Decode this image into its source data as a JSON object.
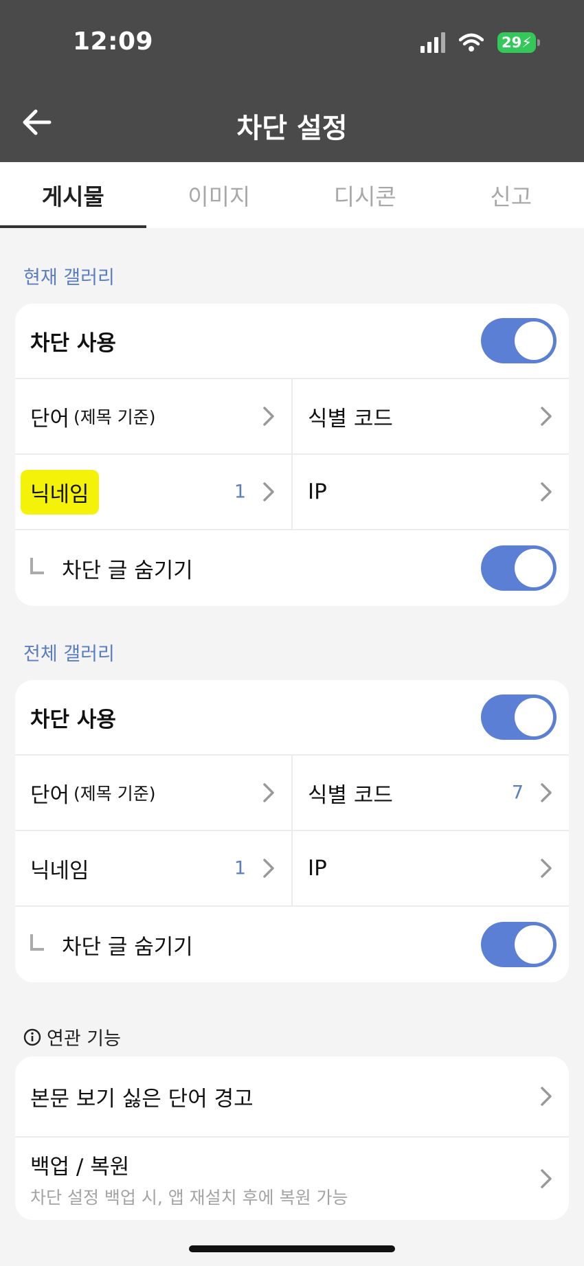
{
  "status_bar": {
    "time": "12:09",
    "battery": "29"
  },
  "header": {
    "title": "차단 설정"
  },
  "tabs": [
    {
      "label": "게시물",
      "active": true
    },
    {
      "label": "이미지",
      "active": false
    },
    {
      "label": "디시콘",
      "active": false
    },
    {
      "label": "신고",
      "active": false
    }
  ],
  "current_gallery": {
    "section_label": "현재 갤러리",
    "use_block_label": "차단 사용",
    "use_block_on": true,
    "word_label": "단어",
    "word_sub": "(제목 기준)",
    "id_code_label": "식별 코드",
    "id_code_count": "",
    "nickname_label": "닉네임",
    "nickname_count": "1",
    "ip_label": "IP",
    "hide_label": "차단 글 숨기기",
    "hide_on": true
  },
  "all_gallery": {
    "section_label": "전체 갤러리",
    "use_block_label": "차단 사용",
    "use_block_on": true,
    "word_label": "단어",
    "word_sub": "(제목 기준)",
    "id_code_label": "식별 코드",
    "id_code_count": "7",
    "nickname_label": "닉네임",
    "nickname_count": "1",
    "ip_label": "IP",
    "hide_label": "차단 글 숨기기",
    "hide_on": true
  },
  "related": {
    "section_label": "연관 기능",
    "items": [
      {
        "title": "본문 보기 싫은 단어 경고",
        "subtitle": ""
      },
      {
        "title": "백업 / 복원",
        "subtitle": "차단 설정 백업 시, 앱 재설치 후에 복원 가능"
      }
    ]
  },
  "colors": {
    "accent": "#5b7fd4",
    "header_bg": "#4a4a4a",
    "highlight": "#f5f20a"
  },
  "icons": [
    "back-arrow-icon",
    "chevron-right-icon",
    "info-icon",
    "wifi-icon",
    "signal-icon",
    "battery-icon"
  ]
}
